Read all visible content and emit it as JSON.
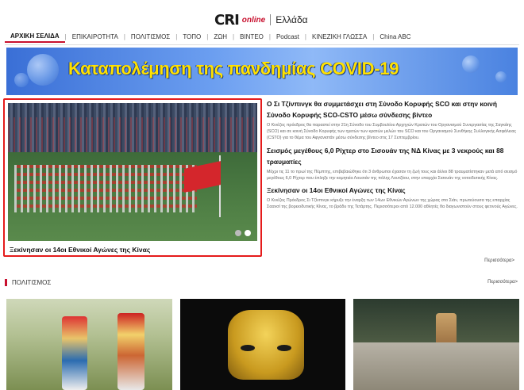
{
  "header": {
    "logo_main": "CRI",
    "logo_sub": "online",
    "language": "Ελλάδα"
  },
  "nav": {
    "items": [
      {
        "label": "ΑΡΧΙΚΗ ΣΕΛΙΔΑ",
        "active": true
      },
      {
        "label": "ΕΠΙΚΑΙΡΟΤΗΤΑ"
      },
      {
        "label": "ΠΟΛΙΤΙΣΜΟΣ"
      },
      {
        "label": "ΤΟΠΟ"
      },
      {
        "label": "ΖΩΗ"
      },
      {
        "label": "ΒΙΝΤΕΟ"
      },
      {
        "label": "Podcast"
      },
      {
        "label": "ΚΙΝΕΖΙΚΗ ΓΛΩΣΣΑ"
      },
      {
        "label": "China ABC"
      }
    ]
  },
  "banner": {
    "text": "Καταπολέμηση της πανδημίας COVID-19",
    "text_color": "#ffe100"
  },
  "featured": {
    "caption": "Ξεκίνησαν οι 14οι Εθνικοί Αγώνες της Κίνας",
    "slides_total": 2,
    "slide_active": 2,
    "highlight_color": "#e51b1b"
  },
  "news": [
    {
      "title": "Ο Σι Τζίνπινγκ θα συμμετάσχει στη Σύνοδο Κορυφής SCO και στην κοινή Σύνοδο Κορυφής SCO-CSTO μέσω σύνδεσης βίντεο",
      "summary": "Ο Κινέζος πρόεδρος θα παραστεί στην 21η Σύνοδο του Συμβουλίου Αρχηγών Κρατών του Οργανισμού Συνεργασίας της Σαγκάης (SCO) και σε κοινή Σύνοδο Κορυφής των ηγετών των κρατών μελών του SCO και του Οργανισμού Συνθήκης Συλλογικής Ασφάλειας (CSTO) για το θέμα του Αφγανιστάν μέσω σύνδεσης βίντεο στις 17 Σεπτεμβρίου."
    },
    {
      "title": "Σεισμός μεγέθους 6,0 Ρίχτερ στο Σισουάν της ΝΔ Κίνας με 3 νεκρούς και 88 τραυματίες",
      "summary": "Μέχρι τις 11 το πρωί της Πέμπτης, επιβεβαιώθηκε ότι 3 άνθρωποι έχασαν τη ζωή τους και άλλοι 88 τραυματίστηκαν μετά από σεισμό μεγέθους 6,0 Ρίχτερ που έπληξε την κομητεία Λουσιάν της πόλης Λουτζόου, στην επαρχία Σισουάν της νοτιοδυτικής Κίνας."
    },
    {
      "title": "Ξεκίνησαν οι 14οι Εθνικοί Αγώνες της Κίνας",
      "summary": "Ο Κινέζος Πρόεδρος Σι Τζίνπινγκ κήρυξε την έναρξη των 14ων Εθνικών Αγώνων της χώρας στο Σιάν, πρωτεύουσα της επαρχίας Σαανσί της βορειοδυτικής Κίνας, το βράδυ της Τετάρτης. Περισσότεροι από 12.000 αθλητές θα διαγωνιστούν στους φετινούς Αγώνες."
    }
  ],
  "news_more": "Περισσότερα>",
  "culture": {
    "title": "ΠΟΛΙΤΙΣΜΟΣ",
    "more": "Περισσότερα>"
  }
}
